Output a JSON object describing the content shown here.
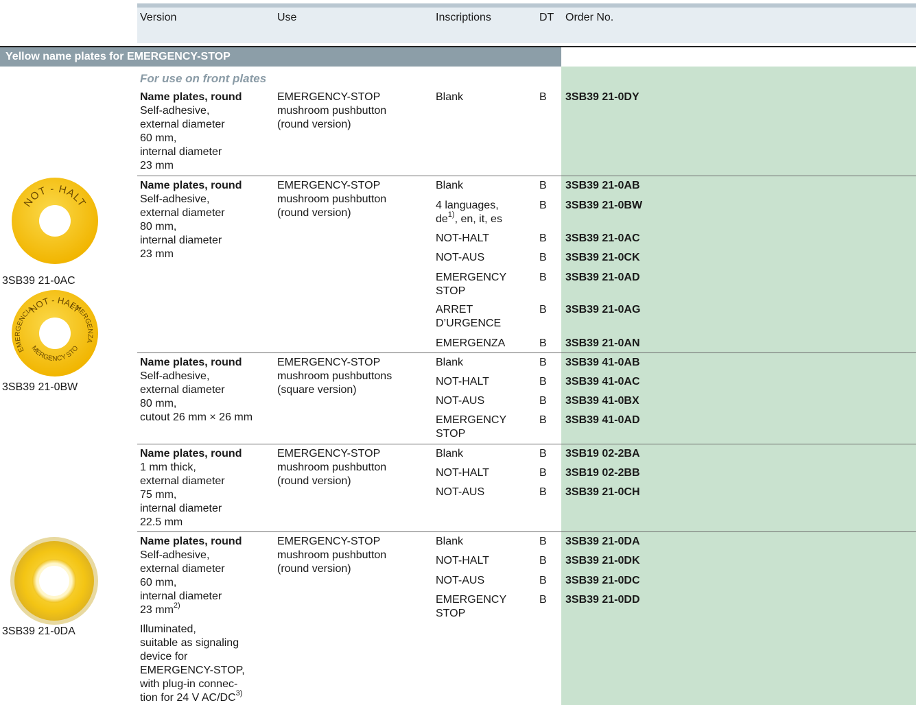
{
  "header": {
    "version": "Version",
    "use": "Use",
    "inscriptions": "Inscriptions",
    "dt": "DT",
    "order_no": "Order No."
  },
  "section_title": "Yellow name plates for EMERGENCY-STOP",
  "subsection_title": "For use on front plates",
  "images": [
    {
      "caption": "3SB39 21-0AC",
      "text": "NOT - HALT",
      "icon": "not-halt-plate-icon"
    },
    {
      "caption": "3SB39 21-0BW",
      "text_top": "NOT - HALT",
      "text_right": "EMERGENZA",
      "text_left": "EMERGENCIA",
      "text_bottom": "EMERGENCY STOP",
      "icon": "multilanguage-plate-icon"
    },
    {
      "caption": "3SB39 21-0DA",
      "icon": "illuminated-plate-icon"
    }
  ],
  "groups": [
    {
      "version_title": "Name plates, round",
      "version_lines": [
        "Self-adhesive,",
        "external diameter",
        "60 mm,",
        "internal diameter",
        "23 mm"
      ],
      "use_lines": [
        "EMERGENCY-STOP",
        "mushroom pushbutton",
        "(round version)"
      ],
      "rows": [
        {
          "inscription": "Blank",
          "dt": "B",
          "order": "3SB39 21-0DY"
        }
      ]
    },
    {
      "version_title": "Name plates, round",
      "version_lines": [
        "Self-adhesive,",
        "external diameter",
        "80 mm,",
        "internal diameter",
        "23 mm"
      ],
      "use_lines": [
        "EMERGENCY-STOP",
        "mushroom pushbutton",
        "(round version)"
      ],
      "rows": [
        {
          "inscription": "Blank",
          "dt": "B",
          "order": "3SB39 21-0AB"
        },
        {
          "inscription_l1": "4 languages,",
          "inscription_l2a": "de",
          "inscription_sup": "1)",
          "inscription_l2b": ", en, it, es",
          "dt": "B",
          "order": "3SB39 21-0BW"
        },
        {
          "inscription": "NOT-HALT",
          "dt": "B",
          "order": "3SB39 21-0AC"
        },
        {
          "inscription": "NOT-AUS",
          "dt": "B",
          "order": "3SB39 21-0CK"
        },
        {
          "inscription_l1": "EMERGENCY",
          "inscription_l2": "STOP",
          "dt": "B",
          "order": "3SB39 21-0AD"
        },
        {
          "inscription_l1": "ARRET",
          "inscription_l2": "D’URGENCE",
          "dt": "B",
          "order": "3SB39 21-0AG"
        },
        {
          "inscription": "EMERGENZA",
          "dt": "B",
          "order": "3SB39 21-0AN"
        }
      ]
    },
    {
      "version_title": "Name plates, round",
      "version_lines": [
        "Self-adhesive,",
        "external diameter",
        "80 mm,",
        "cutout 26 mm × 26 mm"
      ],
      "use_lines": [
        "EMERGENCY-STOP",
        "mushroom pushbuttons",
        "(square version)"
      ],
      "rows": [
        {
          "inscription": "Blank",
          "dt": "B",
          "order": "3SB39 41-0AB"
        },
        {
          "inscription": "NOT-HALT",
          "dt": "B",
          "order": "3SB39 41-0AC"
        },
        {
          "inscription": "NOT-AUS",
          "dt": "B",
          "order": "3SB39 41-0BX"
        },
        {
          "inscription_l1": "EMERGENCY",
          "inscription_l2": "STOP",
          "dt": "B",
          "order": "3SB39 41-0AD"
        }
      ]
    },
    {
      "version_title": "Name plates, round",
      "version_lines": [
        "1 mm thick,",
        "external diameter",
        "75 mm,",
        "internal diameter",
        "22.5 mm"
      ],
      "use_lines": [
        "EMERGENCY-STOP",
        "mushroom pushbutton",
        "(round version)"
      ],
      "rows": [
        {
          "inscription": "Blank",
          "dt": "B",
          "order": "3SB19 02-2BA"
        },
        {
          "inscription": "NOT-HALT",
          "dt": "B",
          "order": "3SB19 02-2BB"
        },
        {
          "inscription": "NOT-AUS",
          "dt": "B",
          "order": "3SB39 21-0CH"
        }
      ]
    },
    {
      "version_title": "Name plates, round",
      "version_lines": [
        "Self-adhesive,",
        "external diameter",
        "60 mm,",
        "internal diameter"
      ],
      "version_last_a": "23 mm",
      "version_last_sup": "2)",
      "version_extra_lines": [
        "Illuminated,",
        "suitable as signaling",
        "device for",
        "EMERGENCY-STOP,",
        "with plug-in connec-"
      ],
      "version_extra_last_a": "tion for 24 V AC/DC",
      "version_extra_last_sup": "3)",
      "use_lines": [
        "EMERGENCY-STOP",
        "mushroom pushbutton",
        "(round version)"
      ],
      "rows": [
        {
          "inscription": "Blank",
          "dt": "B",
          "order": "3SB39 21-0DA"
        },
        {
          "inscription": "NOT-HALT",
          "dt": "B",
          "order": "3SB39 21-0DK"
        },
        {
          "inscription": "NOT-AUS",
          "dt": "B",
          "order": "3SB39 21-0DC"
        },
        {
          "inscription_l1": "EMERGENCY",
          "inscription_l2": "STOP",
          "dt": "B",
          "order": "3SB39 21-0DD"
        }
      ]
    }
  ],
  "colors": {
    "order_column_bg": "#c9e2cf",
    "section_bar": "#8c9ea8",
    "header_bg": "#e6edf2",
    "plate_yellow": "#f6c21a"
  }
}
